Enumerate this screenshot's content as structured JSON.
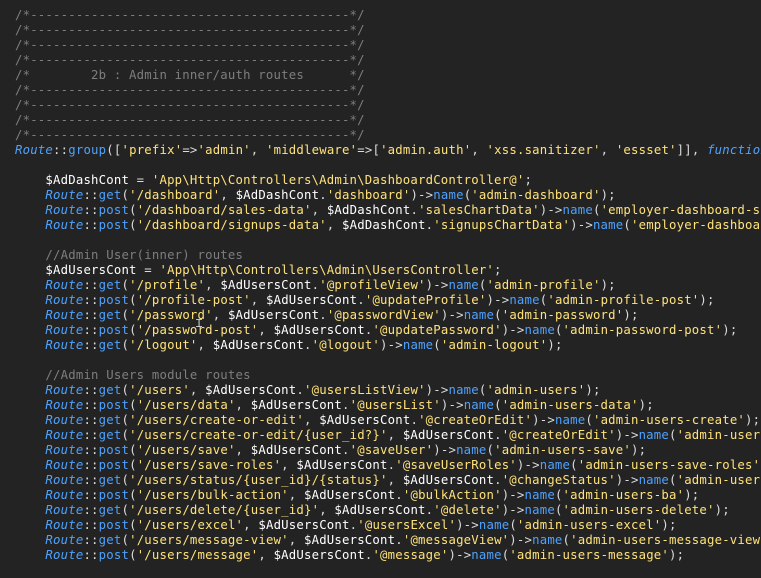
{
  "colors": {
    "background": "#232323",
    "comment": "#7e7e7e",
    "class_and_function": "#4ea2ff",
    "string": "#ffe27a",
    "variable": "#ffffff",
    "punctuation": "#dcdcdc"
  },
  "mouse_cursor": "text-cursor-icon",
  "lines": [
    [
      [
        "cmt",
        "/*------------------------------------------*/"
      ]
    ],
    [
      [
        "cmt",
        "/*------------------------------------------*/"
      ]
    ],
    [
      [
        "cmt",
        "/*------------------------------------------*/"
      ]
    ],
    [
      [
        "cmt",
        "/*------------------------------------------*/"
      ]
    ],
    [
      [
        "cmt",
        "/*        2b : Admin inner/auth routes      */"
      ]
    ],
    [
      [
        "cmt",
        "/*------------------------------------------*/"
      ]
    ],
    [
      [
        "cmt",
        "/*------------------------------------------*/"
      ]
    ],
    [
      [
        "cmt",
        "/*------------------------------------------*/"
      ]
    ],
    [
      [
        "cmt",
        "/*------------------------------------------*/"
      ]
    ],
    [
      [
        "cls",
        "Route"
      ],
      [
        "op",
        "::"
      ],
      [
        "fn",
        "group"
      ],
      [
        "pun",
        "(["
      ],
      [
        "str",
        "'prefix'"
      ],
      [
        "op",
        "=>"
      ],
      [
        "str",
        "'admin'"
      ],
      [
        "pun",
        ", "
      ],
      [
        "str",
        "'middleware'"
      ],
      [
        "op",
        "=>"
      ],
      [
        "pun",
        "["
      ],
      [
        "str",
        "'admin.auth'"
      ],
      [
        "pun",
        ", "
      ],
      [
        "str",
        "'xss.sanitizer'"
      ],
      [
        "pun",
        ", "
      ],
      [
        "str",
        "'essset'"
      ],
      [
        "pun",
        "]], "
      ],
      [
        "kw",
        "function"
      ],
      [
        "pun",
        "() {"
      ]
    ],
    [],
    [
      [
        "pun",
        "    "
      ],
      [
        "var",
        "$AdDashCont"
      ],
      [
        "op",
        " = "
      ],
      [
        "str",
        "'App\\Http\\Controllers\\Admin\\DashboardController@'"
      ],
      [
        "pun",
        ";"
      ]
    ],
    [
      [
        "pun",
        "    "
      ],
      [
        "cls",
        "Route"
      ],
      [
        "op",
        "::"
      ],
      [
        "fn",
        "get"
      ],
      [
        "pun",
        "("
      ],
      [
        "str",
        "'/dashboard'"
      ],
      [
        "pun",
        ", "
      ],
      [
        "var",
        "$AdDashCont"
      ],
      [
        "op",
        "."
      ],
      [
        "str",
        "'dashboard'"
      ],
      [
        "pun",
        ")->"
      ],
      [
        "fn",
        "name"
      ],
      [
        "pun",
        "("
      ],
      [
        "str",
        "'admin-dashboard'"
      ],
      [
        "pun",
        ");"
      ]
    ],
    [
      [
        "pun",
        "    "
      ],
      [
        "cls",
        "Route"
      ],
      [
        "op",
        "::"
      ],
      [
        "fn",
        "post"
      ],
      [
        "pun",
        "("
      ],
      [
        "str",
        "'/dashboard/sales-data'"
      ],
      [
        "pun",
        ", "
      ],
      [
        "var",
        "$AdDashCont"
      ],
      [
        "op",
        "."
      ],
      [
        "str",
        "'salesChartData'"
      ],
      [
        "pun",
        ")->"
      ],
      [
        "fn",
        "name"
      ],
      [
        "pun",
        "("
      ],
      [
        "str",
        "'employer-dashboard-sales-data'"
      ],
      [
        "pun",
        ");"
      ]
    ],
    [
      [
        "pun",
        "    "
      ],
      [
        "cls",
        "Route"
      ],
      [
        "op",
        "::"
      ],
      [
        "fn",
        "post"
      ],
      [
        "pun",
        "("
      ],
      [
        "str",
        "'/dashboard/signups-data'"
      ],
      [
        "pun",
        ", "
      ],
      [
        "var",
        "$AdDashCont"
      ],
      [
        "op",
        "."
      ],
      [
        "str",
        "'signupsChartData'"
      ],
      [
        "pun",
        ")->"
      ],
      [
        "fn",
        "name"
      ],
      [
        "pun",
        "("
      ],
      [
        "str",
        "'employer-dashboard-signups-data'"
      ],
      [
        "pun",
        ");"
      ]
    ],
    [],
    [
      [
        "pun",
        "    "
      ],
      [
        "cmt",
        "//Admin User(inner) routes"
      ]
    ],
    [
      [
        "pun",
        "    "
      ],
      [
        "var",
        "$AdUsersCont"
      ],
      [
        "op",
        " = "
      ],
      [
        "str",
        "'App\\Http\\Controllers\\Admin\\UsersController'"
      ],
      [
        "pun",
        ";"
      ]
    ],
    [
      [
        "pun",
        "    "
      ],
      [
        "cls",
        "Route"
      ],
      [
        "op",
        "::"
      ],
      [
        "fn",
        "get"
      ],
      [
        "pun",
        "("
      ],
      [
        "str",
        "'/profile'"
      ],
      [
        "pun",
        ", "
      ],
      [
        "var",
        "$AdUsersCont"
      ],
      [
        "op",
        "."
      ],
      [
        "str",
        "'@profileView'"
      ],
      [
        "pun",
        ")->"
      ],
      [
        "fn",
        "name"
      ],
      [
        "pun",
        "("
      ],
      [
        "str",
        "'admin-profile'"
      ],
      [
        "pun",
        ");"
      ]
    ],
    [
      [
        "pun",
        "    "
      ],
      [
        "cls",
        "Route"
      ],
      [
        "op",
        "::"
      ],
      [
        "fn",
        "post"
      ],
      [
        "pun",
        "("
      ],
      [
        "str",
        "'/profile-post'"
      ],
      [
        "pun",
        ", "
      ],
      [
        "var",
        "$AdUsersCont"
      ],
      [
        "op",
        "."
      ],
      [
        "str",
        "'@updateProfile'"
      ],
      [
        "pun",
        ")->"
      ],
      [
        "fn",
        "name"
      ],
      [
        "pun",
        "("
      ],
      [
        "str",
        "'admin-profile-post'"
      ],
      [
        "pun",
        ");"
      ]
    ],
    [
      [
        "pun",
        "    "
      ],
      [
        "cls",
        "Route"
      ],
      [
        "op",
        "::"
      ],
      [
        "fn",
        "get"
      ],
      [
        "pun",
        "("
      ],
      [
        "str",
        "'/password'"
      ],
      [
        "pun",
        ", "
      ],
      [
        "var",
        "$AdUsersCont"
      ],
      [
        "op",
        "."
      ],
      [
        "str",
        "'@passwordView'"
      ],
      [
        "pun",
        ")->"
      ],
      [
        "fn",
        "name"
      ],
      [
        "pun",
        "("
      ],
      [
        "str",
        "'admin-password'"
      ],
      [
        "pun",
        ");"
      ]
    ],
    [
      [
        "pun",
        "    "
      ],
      [
        "cls",
        "Route"
      ],
      [
        "op",
        "::"
      ],
      [
        "fn",
        "post"
      ],
      [
        "pun",
        "("
      ],
      [
        "str",
        "'/password-post'"
      ],
      [
        "pun",
        ", "
      ],
      [
        "var",
        "$AdUsersCont"
      ],
      [
        "op",
        "."
      ],
      [
        "str",
        "'@updatePassword'"
      ],
      [
        "pun",
        ")->"
      ],
      [
        "fn",
        "name"
      ],
      [
        "pun",
        "("
      ],
      [
        "str",
        "'admin-password-post'"
      ],
      [
        "pun",
        ");"
      ]
    ],
    [
      [
        "pun",
        "    "
      ],
      [
        "cls",
        "Route"
      ],
      [
        "op",
        "::"
      ],
      [
        "fn",
        "get"
      ],
      [
        "pun",
        "("
      ],
      [
        "str",
        "'/logout'"
      ],
      [
        "pun",
        ", "
      ],
      [
        "var",
        "$AdUsersCont"
      ],
      [
        "op",
        "."
      ],
      [
        "str",
        "'@logout'"
      ],
      [
        "pun",
        ")->"
      ],
      [
        "fn",
        "name"
      ],
      [
        "pun",
        "("
      ],
      [
        "str",
        "'admin-logout'"
      ],
      [
        "pun",
        ");"
      ]
    ],
    [],
    [
      [
        "pun",
        "    "
      ],
      [
        "cmt",
        "//Admin Users module routes"
      ]
    ],
    [
      [
        "pun",
        "    "
      ],
      [
        "cls",
        "Route"
      ],
      [
        "op",
        "::"
      ],
      [
        "fn",
        "get"
      ],
      [
        "pun",
        "("
      ],
      [
        "str",
        "'/users'"
      ],
      [
        "pun",
        ", "
      ],
      [
        "var",
        "$AdUsersCont"
      ],
      [
        "op",
        "."
      ],
      [
        "str",
        "'@usersListView'"
      ],
      [
        "pun",
        ")->"
      ],
      [
        "fn",
        "name"
      ],
      [
        "pun",
        "("
      ],
      [
        "str",
        "'admin-users'"
      ],
      [
        "pun",
        ");"
      ]
    ],
    [
      [
        "pun",
        "    "
      ],
      [
        "cls",
        "Route"
      ],
      [
        "op",
        "::"
      ],
      [
        "fn",
        "post"
      ],
      [
        "pun",
        "("
      ],
      [
        "str",
        "'/users/data'"
      ],
      [
        "pun",
        ", "
      ],
      [
        "var",
        "$AdUsersCont"
      ],
      [
        "op",
        "."
      ],
      [
        "str",
        "'@usersList'"
      ],
      [
        "pun",
        ")->"
      ],
      [
        "fn",
        "name"
      ],
      [
        "pun",
        "("
      ],
      [
        "str",
        "'admin-users-data'"
      ],
      [
        "pun",
        ");"
      ]
    ],
    [
      [
        "pun",
        "    "
      ],
      [
        "cls",
        "Route"
      ],
      [
        "op",
        "::"
      ],
      [
        "fn",
        "get"
      ],
      [
        "pun",
        "("
      ],
      [
        "str",
        "'/users/create-or-edit'"
      ],
      [
        "pun",
        ", "
      ],
      [
        "var",
        "$AdUsersCont"
      ],
      [
        "op",
        "."
      ],
      [
        "str",
        "'@createOrEdit'"
      ],
      [
        "pun",
        ")->"
      ],
      [
        "fn",
        "name"
      ],
      [
        "pun",
        "("
      ],
      [
        "str",
        "'admin-users-create'"
      ],
      [
        "pun",
        ");"
      ]
    ],
    [
      [
        "pun",
        "    "
      ],
      [
        "cls",
        "Route"
      ],
      [
        "op",
        "::"
      ],
      [
        "fn",
        "get"
      ],
      [
        "pun",
        "("
      ],
      [
        "str",
        "'/users/create-or-edit/{user_id?}'"
      ],
      [
        "pun",
        ", "
      ],
      [
        "var",
        "$AdUsersCont"
      ],
      [
        "op",
        "."
      ],
      [
        "str",
        "'@createOrEdit'"
      ],
      [
        "pun",
        ")->"
      ],
      [
        "fn",
        "name"
      ],
      [
        "pun",
        "("
      ],
      [
        "str",
        "'admin-users-edit'"
      ],
      [
        "pun",
        ");"
      ]
    ],
    [
      [
        "pun",
        "    "
      ],
      [
        "cls",
        "Route"
      ],
      [
        "op",
        "::"
      ],
      [
        "fn",
        "post"
      ],
      [
        "pun",
        "("
      ],
      [
        "str",
        "'/users/save'"
      ],
      [
        "pun",
        ", "
      ],
      [
        "var",
        "$AdUsersCont"
      ],
      [
        "op",
        "."
      ],
      [
        "str",
        "'@saveUser'"
      ],
      [
        "pun",
        ")->"
      ],
      [
        "fn",
        "name"
      ],
      [
        "pun",
        "("
      ],
      [
        "str",
        "'admin-users-save'"
      ],
      [
        "pun",
        ");"
      ]
    ],
    [
      [
        "pun",
        "    "
      ],
      [
        "cls",
        "Route"
      ],
      [
        "op",
        "::"
      ],
      [
        "fn",
        "post"
      ],
      [
        "pun",
        "("
      ],
      [
        "str",
        "'/users/save-roles'"
      ],
      [
        "pun",
        ", "
      ],
      [
        "var",
        "$AdUsersCont"
      ],
      [
        "op",
        "."
      ],
      [
        "str",
        "'@saveUserRoles'"
      ],
      [
        "pun",
        ")->"
      ],
      [
        "fn",
        "name"
      ],
      [
        "pun",
        "("
      ],
      [
        "str",
        "'admin-users-save-roles'"
      ],
      [
        "pun",
        ");"
      ]
    ],
    [
      [
        "pun",
        "    "
      ],
      [
        "cls",
        "Route"
      ],
      [
        "op",
        "::"
      ],
      [
        "fn",
        "get"
      ],
      [
        "pun",
        "("
      ],
      [
        "str",
        "'/users/status/{user_id}/{status}'"
      ],
      [
        "pun",
        ", "
      ],
      [
        "var",
        "$AdUsersCont"
      ],
      [
        "op",
        "."
      ],
      [
        "str",
        "'@changeStatus'"
      ],
      [
        "pun",
        ")->"
      ],
      [
        "fn",
        "name"
      ],
      [
        "pun",
        "("
      ],
      [
        "str",
        "'admin-users-status'"
      ],
      [
        "pun",
        ");"
      ]
    ],
    [
      [
        "pun",
        "    "
      ],
      [
        "cls",
        "Route"
      ],
      [
        "op",
        "::"
      ],
      [
        "fn",
        "post"
      ],
      [
        "pun",
        "("
      ],
      [
        "str",
        "'/users/bulk-action'"
      ],
      [
        "pun",
        ", "
      ],
      [
        "var",
        "$AdUsersCont"
      ],
      [
        "op",
        "."
      ],
      [
        "str",
        "'@bulkAction'"
      ],
      [
        "pun",
        ")->"
      ],
      [
        "fn",
        "name"
      ],
      [
        "pun",
        "("
      ],
      [
        "str",
        "'admin-users-ba'"
      ],
      [
        "pun",
        ");"
      ]
    ],
    [
      [
        "pun",
        "    "
      ],
      [
        "cls",
        "Route"
      ],
      [
        "op",
        "::"
      ],
      [
        "fn",
        "get"
      ],
      [
        "pun",
        "("
      ],
      [
        "str",
        "'/users/delete/{user_id}'"
      ],
      [
        "pun",
        ", "
      ],
      [
        "var",
        "$AdUsersCont"
      ],
      [
        "op",
        "."
      ],
      [
        "str",
        "'@delete'"
      ],
      [
        "pun",
        ")->"
      ],
      [
        "fn",
        "name"
      ],
      [
        "pun",
        "("
      ],
      [
        "str",
        "'admin-users-delete'"
      ],
      [
        "pun",
        ");"
      ]
    ],
    [
      [
        "pun",
        "    "
      ],
      [
        "cls",
        "Route"
      ],
      [
        "op",
        "::"
      ],
      [
        "fn",
        "post"
      ],
      [
        "pun",
        "("
      ],
      [
        "str",
        "'/users/excel'"
      ],
      [
        "pun",
        ", "
      ],
      [
        "var",
        "$AdUsersCont"
      ],
      [
        "op",
        "."
      ],
      [
        "str",
        "'@usersExcel'"
      ],
      [
        "pun",
        ")->"
      ],
      [
        "fn",
        "name"
      ],
      [
        "pun",
        "("
      ],
      [
        "str",
        "'admin-users-excel'"
      ],
      [
        "pun",
        ");"
      ]
    ],
    [
      [
        "pun",
        "    "
      ],
      [
        "cls",
        "Route"
      ],
      [
        "op",
        "::"
      ],
      [
        "fn",
        "get"
      ],
      [
        "pun",
        "("
      ],
      [
        "str",
        "'/users/message-view'"
      ],
      [
        "pun",
        ", "
      ],
      [
        "var",
        "$AdUsersCont"
      ],
      [
        "op",
        "."
      ],
      [
        "str",
        "'@messageView'"
      ],
      [
        "pun",
        ")->"
      ],
      [
        "fn",
        "name"
      ],
      [
        "pun",
        "("
      ],
      [
        "str",
        "'admin-users-message-view'"
      ],
      [
        "pun",
        ");"
      ]
    ],
    [
      [
        "pun",
        "    "
      ],
      [
        "cls",
        "Route"
      ],
      [
        "op",
        "::"
      ],
      [
        "fn",
        "post"
      ],
      [
        "pun",
        "("
      ],
      [
        "str",
        "'/users/message'"
      ],
      [
        "pun",
        ", "
      ],
      [
        "var",
        "$AdUsersCont"
      ],
      [
        "op",
        "."
      ],
      [
        "str",
        "'@message'"
      ],
      [
        "pun",
        ")->"
      ],
      [
        "fn",
        "name"
      ],
      [
        "pun",
        "("
      ],
      [
        "str",
        "'admin-users-message'"
      ],
      [
        "pun",
        ");"
      ]
    ]
  ]
}
